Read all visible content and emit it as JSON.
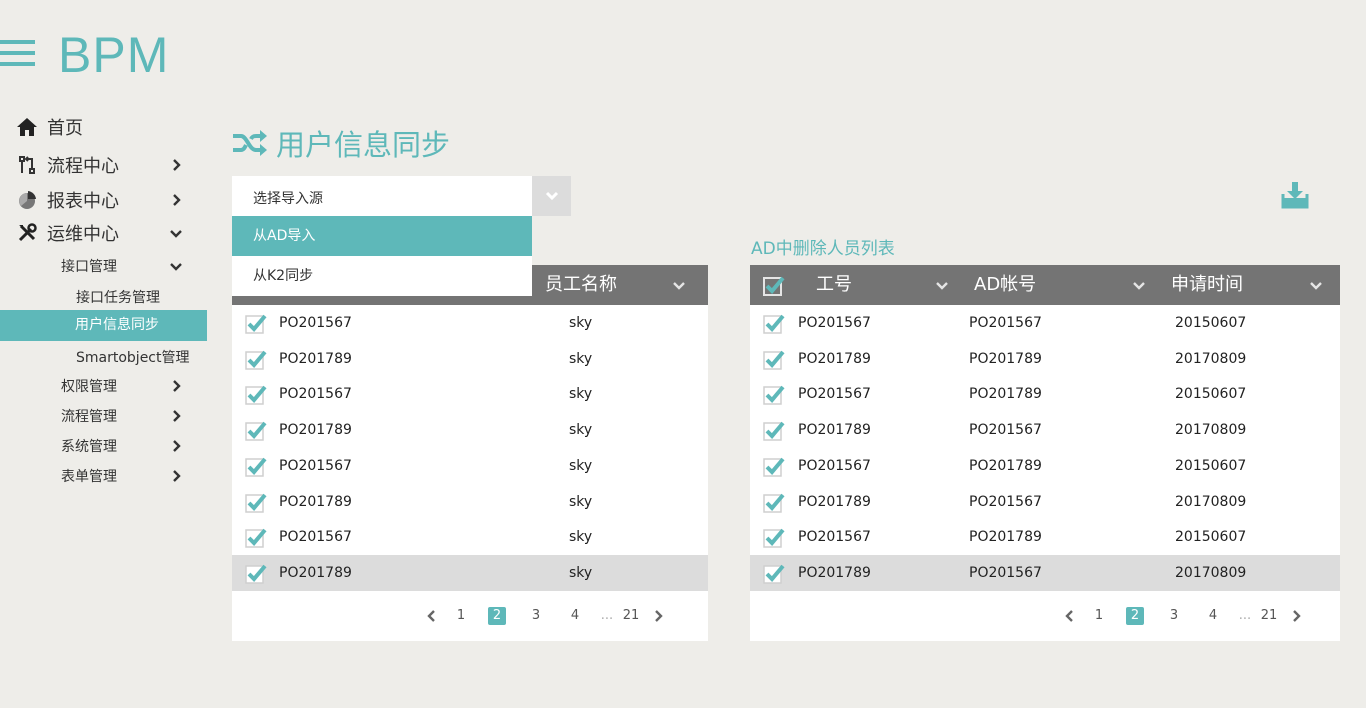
{
  "app": {
    "logo": "BPM"
  },
  "sidebar": {
    "items": [
      {
        "label": "首页"
      },
      {
        "label": "流程中心"
      },
      {
        "label": "报表中心"
      },
      {
        "label": "运维中心"
      }
    ],
    "sub": {
      "interface_mgmt": "接口管理",
      "interface_task": "接口任务管理",
      "user_sync": "用户信息同步",
      "smartobject": "Smartobject管理",
      "permission": "权限管理",
      "process": "流程管理",
      "system": "系统管理",
      "form": "表单管理"
    }
  },
  "page": {
    "title": "用户信息同步"
  },
  "import_select": {
    "value": "选择导入源",
    "options": [
      "从AD导入",
      "从K2同步"
    ]
  },
  "right_caption": "AD中删除人员列表",
  "left_table": {
    "visible_header": "员工名称",
    "rows": [
      {
        "id": "PO201567",
        "name": "sky"
      },
      {
        "id": "PO201789",
        "name": "sky"
      },
      {
        "id": "PO201567",
        "name": "sky"
      },
      {
        "id": "PO201789",
        "name": "sky"
      },
      {
        "id": "PO201567",
        "name": "sky"
      },
      {
        "id": "PO201789",
        "name": "sky"
      },
      {
        "id": "PO201567",
        "name": "sky"
      },
      {
        "id": "PO201789",
        "name": "sky"
      }
    ]
  },
  "right_table": {
    "headers": [
      "工号",
      "AD帐号",
      "申请时间"
    ],
    "rows": [
      {
        "id": "PO201567",
        "ad": "PO201567",
        "date": "20150607"
      },
      {
        "id": "PO201789",
        "ad": "PO201789",
        "date": "20170809"
      },
      {
        "id": "PO201567",
        "ad": "PO201789",
        "date": "20150607"
      },
      {
        "id": "PO201789",
        "ad": "PO201567",
        "date": "20170809"
      },
      {
        "id": "PO201567",
        "ad": "PO201789",
        "date": "20150607"
      },
      {
        "id": "PO201789",
        "ad": "PO201567",
        "date": "20170809"
      },
      {
        "id": "PO201567",
        "ad": "PO201789",
        "date": "20150607"
      },
      {
        "id": "PO201789",
        "ad": "PO201567",
        "date": "20170809"
      }
    ]
  },
  "pagination": {
    "pages": [
      "1",
      "2",
      "3",
      "4",
      "...",
      "21"
    ],
    "current": "2"
  },
  "colors": {
    "accent": "#5eb8b9",
    "header_bg": "#747474",
    "page_bg": "#eeede9",
    "selected_row": "#dcdcdc"
  }
}
